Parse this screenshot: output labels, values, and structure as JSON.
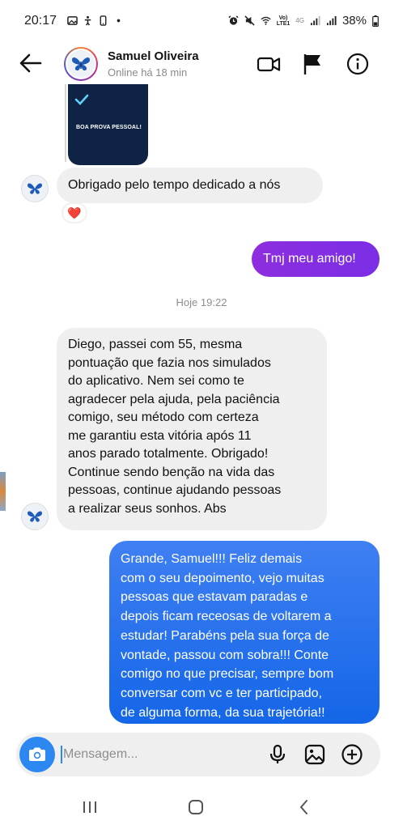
{
  "status_bar": {
    "time": "20:17",
    "lte_top": "Vo)",
    "lte_bottom": "LTE1",
    "network": "4G",
    "battery": "38%"
  },
  "header": {
    "contact_name": "Samuel Oliveira",
    "contact_status": "Online há 18 min"
  },
  "chat": {
    "shared_card_text": "BOA PROVA PESSOAL!",
    "messages": [
      {
        "text": "Obrigado pelo tempo dedicado a nós",
        "reaction": "❤️"
      },
      {
        "text": "Tmj meu amigo!"
      },
      {
        "text": "Diego, passei com 55, mesma pontuação que fazia nos simulados do aplicativo. Nem sei como te agradecer pela ajuda, pela paciência comigo, seu método com certeza me garantiu esta vitória após 11 anos parado totalmente. Obrigado! Continue sendo benção na vida das pessoas, continue ajudando pessoas a realizar seus sonhos. Abs"
      },
      {
        "text": "Grande, Samuel!!! Feliz demais com o seu depoimento, vejo muitas pessoas que estavam paradas e depois ficam receosas de voltarem a estudar! Parabéns pela sua força de vontade, passou com sobra!!! Conte comigo no que precisar, sempre bom conversar com vc e ter participado, de alguma forma, da sua trajetória!!"
      }
    ],
    "day_separator": "Hoje 19:22",
    "long_message_lines": [
      "Diego, passei com 55, mesma",
      "pontuação que fazia nos simulados",
      "do aplicativo. Nem sei como te",
      "agradecer pela ajuda, pela paciência",
      "comigo, seu método com certeza",
      "me garantiu esta vitória após 11",
      "anos parado totalmente. Obrigado!",
      "Continue sendo benção na vida das",
      "pessoas, continue ajudando pessoas",
      "a realizar seus sonhos. Abs"
    ],
    "reply_lines": [
      "Grande, Samuel!!! Feliz demais",
      "com o seu depoimento, vejo muitas",
      "pessoas que estavam paradas e",
      "depois ficam receosas de voltarem a",
      "estudar! Parabéns pela sua força de",
      "vontade, passou com sobra!!! Conte",
      "comigo no que precisar, sempre bom",
      "conversar com vc e ter participado,",
      "de alguma forma, da sua trajetória!!"
    ]
  },
  "composer": {
    "placeholder": "Mensagem...",
    "value": ""
  },
  "colors": {
    "accent_blue": "#1c70ef",
    "accent_purple": "#8a2be2",
    "incoming_bubble": "#efefef"
  },
  "icons": [
    "back-arrow-icon",
    "video-call-icon",
    "flag-icon",
    "info-icon",
    "camera-icon",
    "microphone-icon",
    "gallery-icon",
    "add-icon",
    "recent-apps-icon",
    "home-icon",
    "nav-back-icon"
  ]
}
